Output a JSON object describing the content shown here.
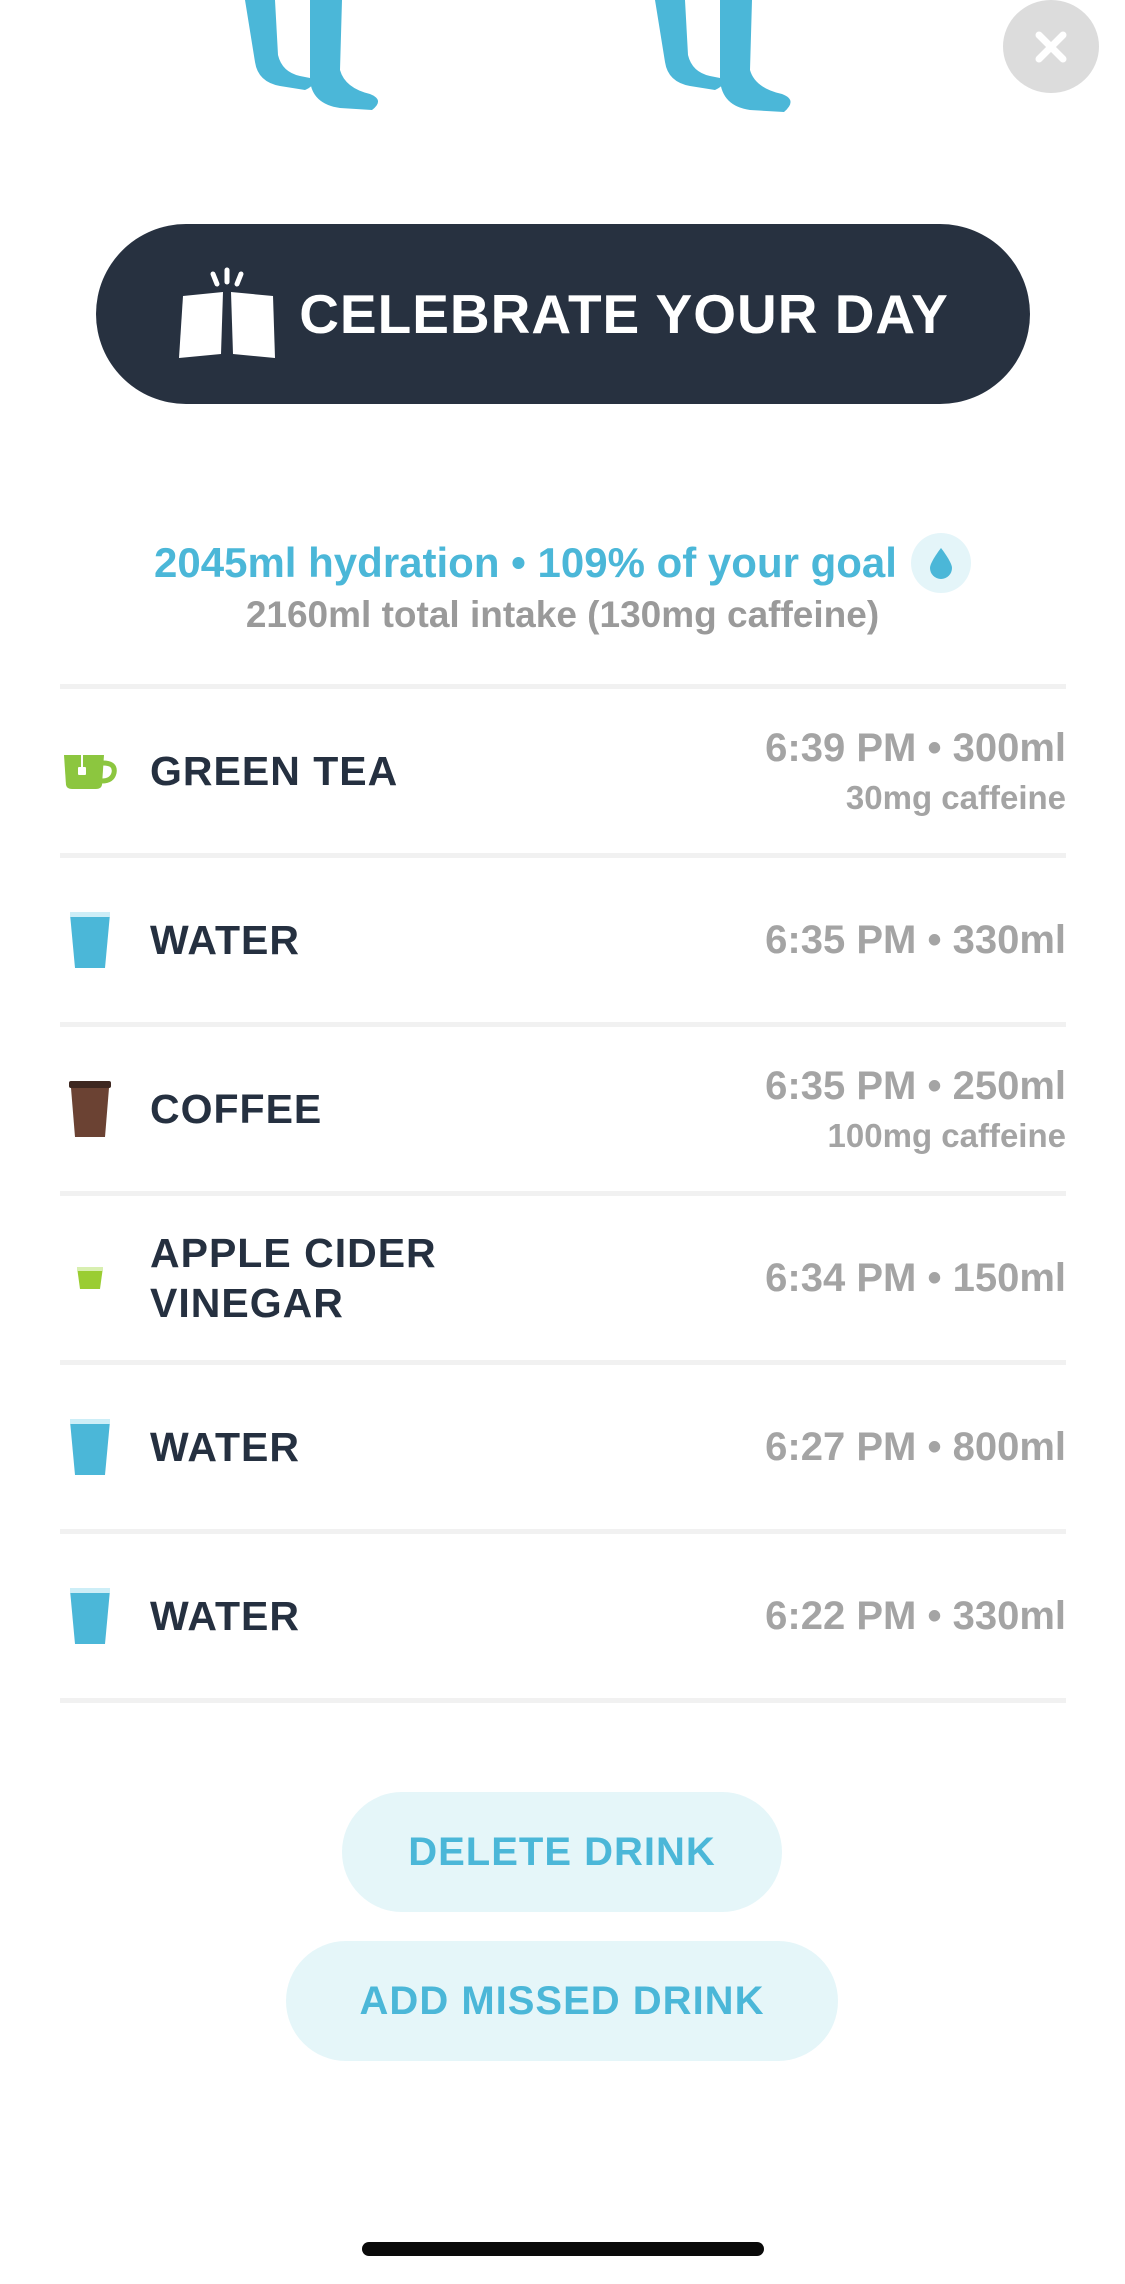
{
  "close": {
    "icon": "close-icon"
  },
  "celebrate": {
    "label": "CELEBRATE YOUR DAY",
    "icon": "cheers-icon"
  },
  "summary": {
    "hydration": "2045ml hydration • 109% of your goal",
    "total": "2160ml total intake (130mg caffeine)",
    "icon": "water-drop-icon"
  },
  "drinks": [
    {
      "name": "GREEN TEA",
      "time": "6:39 PM • 300ml",
      "caffeine": "30mg caffeine",
      "icon": "tea-cup-icon",
      "color": "#8cc63f"
    },
    {
      "name": "WATER",
      "time": "6:35 PM • 330ml",
      "caffeine": "",
      "icon": "water-glass-icon",
      "color": "#4bb7d8"
    },
    {
      "name": "COFFEE",
      "time": "6:35 PM • 250ml",
      "caffeine": "100mg caffeine",
      "icon": "coffee-cup-icon",
      "color": "#6b4233"
    },
    {
      "name": "APPLE CIDER\nVINEGAR",
      "time": "6:34 PM • 150ml",
      "caffeine": "",
      "icon": "shot-glass-icon",
      "color": "#9acd32"
    },
    {
      "name": "WATER",
      "time": "6:27 PM • 800ml",
      "caffeine": "",
      "icon": "water-glass-icon",
      "color": "#4bb7d8"
    },
    {
      "name": "WATER",
      "time": "6:22 PM • 330ml",
      "caffeine": "",
      "icon": "water-glass-icon",
      "color": "#4bb7d8"
    }
  ],
  "actions": {
    "delete": "DELETE DRINK",
    "add": "ADD MISSED DRINK"
  },
  "colors": {
    "accent": "#4bb7d8",
    "dark": "#273140",
    "muted": "#a4a4a4"
  }
}
